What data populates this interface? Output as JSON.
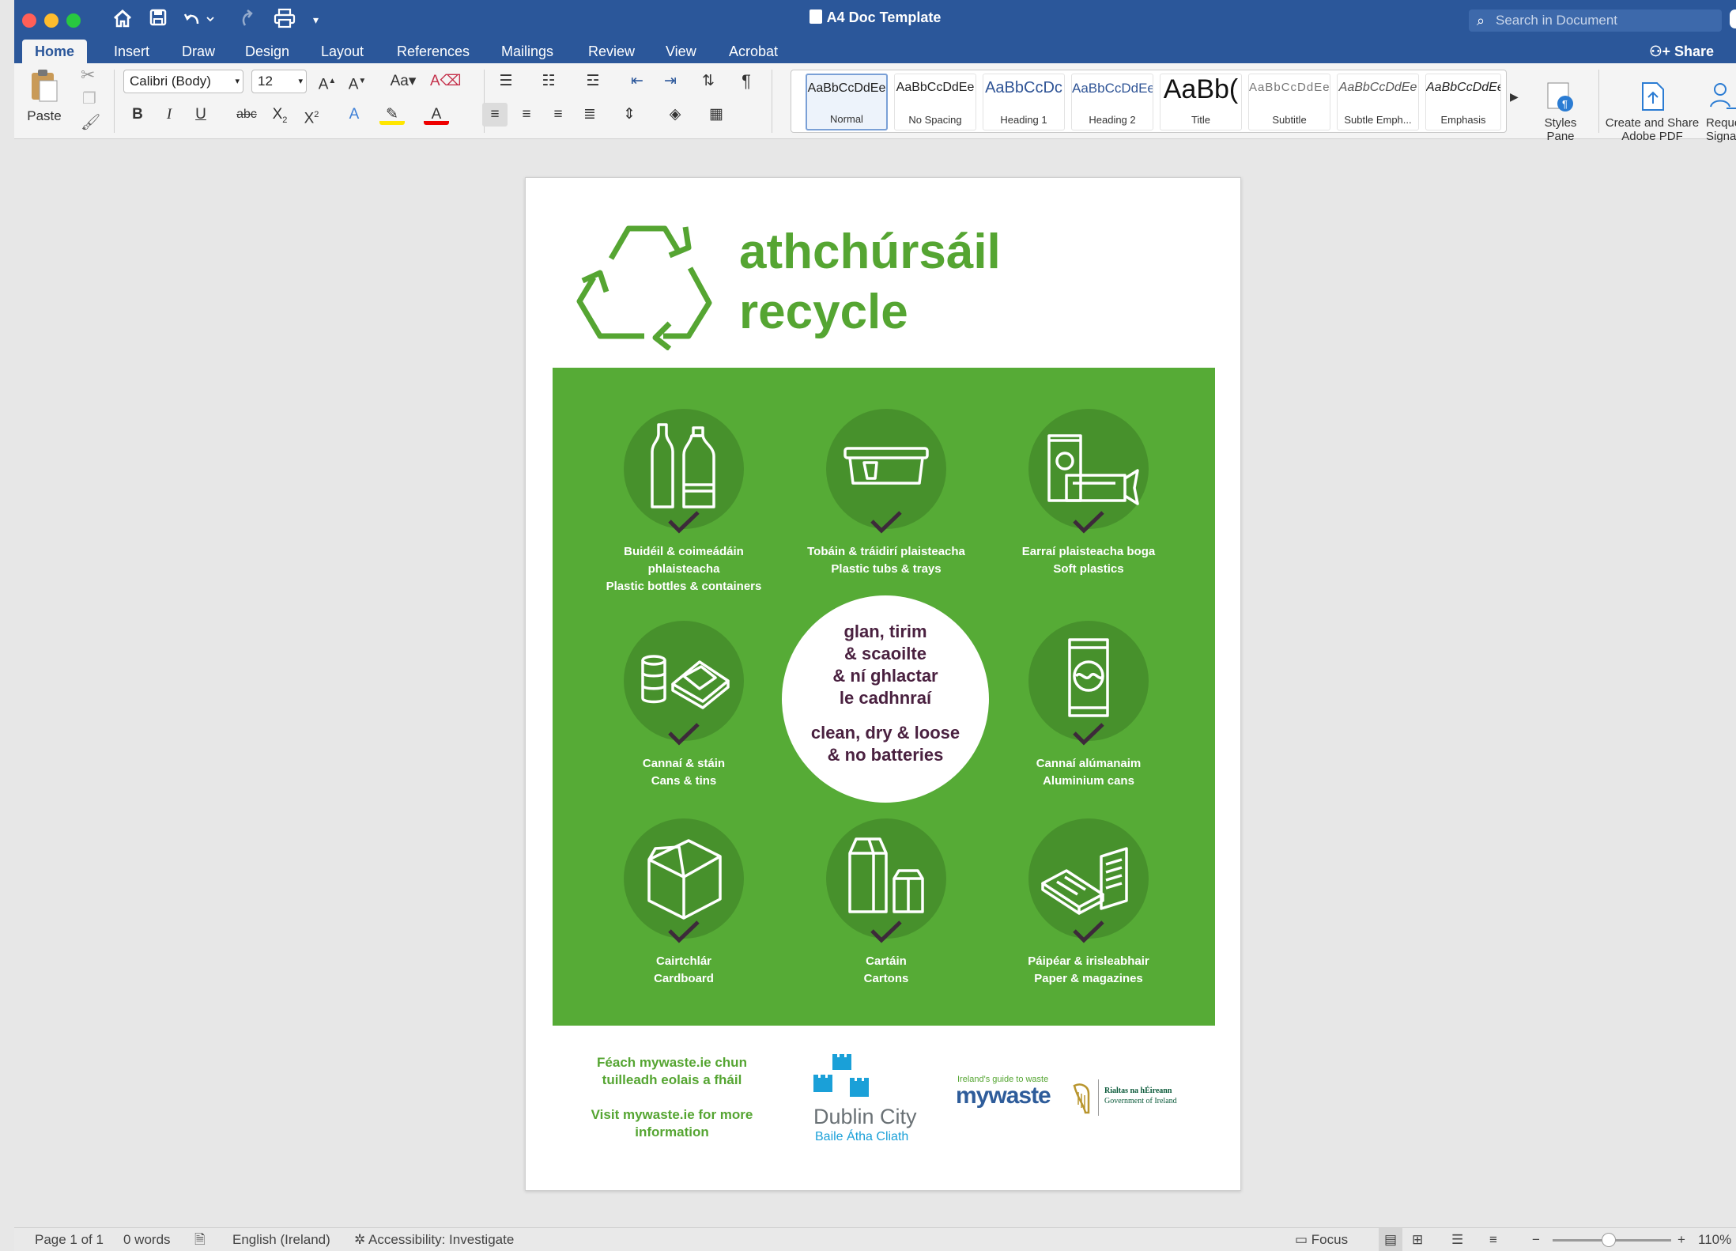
{
  "window": {
    "title": "A4 Doc Template",
    "search_placeholder": "Search in Document"
  },
  "tabs": [
    "Home",
    "Insert",
    "Draw",
    "Design",
    "Layout",
    "References",
    "Mailings",
    "Review",
    "View",
    "Acrobat"
  ],
  "share_label": "Share",
  "ribbon": {
    "paste_label": "Paste",
    "font_name": "Calibri (Body)",
    "font_size": "12",
    "bold": "B",
    "italic": "I",
    "underline": "U",
    "strikethrough": "abc",
    "styles": [
      {
        "preview": "AaBbCcDdEe",
        "name": "Normal"
      },
      {
        "preview": "AaBbCcDdEe",
        "name": "No Spacing"
      },
      {
        "preview": "AaBbCcDc",
        "name": "Heading 1"
      },
      {
        "preview": "AaBbCcDdEe",
        "name": "Heading 2"
      },
      {
        "preview": "AaBb(",
        "name": "Title"
      },
      {
        "preview": "AaBbCcDdEe",
        "name": "Subtitle"
      },
      {
        "preview": "AaBbCcDdEe",
        "name": "Subtle Emph..."
      },
      {
        "preview": "AaBbCcDdEe",
        "name": "Emphasis"
      }
    ],
    "styles_pane": "Styles\nPane",
    "create_share_pdf": "Create and Share\nAdobe PDF",
    "request_signatures": "Request\nSignatures"
  },
  "document": {
    "headline_irish": "athchúrsáil",
    "headline_english": "recycle",
    "items": [
      {
        "irish": "Buidéil & coimeádáin phlaisteacha",
        "english": "Plastic bottles & containers",
        "icon": "bottles-icon"
      },
      {
        "irish": "Tobáin & tráidirí plaisteacha",
        "english": "Plastic tubs & trays",
        "icon": "tub-icon"
      },
      {
        "irish": "Earraí plaisteacha boga",
        "english": "Soft plastics",
        "icon": "soft-plastics-icon"
      },
      {
        "irish": "Cannaí & stáin",
        "english": "Cans & tins",
        "icon": "tins-icon"
      },
      {
        "irish": "Cannaí alúmanaim",
        "english": "Aluminium cans",
        "icon": "can-icon"
      },
      {
        "irish": "Cairtchlár",
        "english": "Cardboard",
        "icon": "cardboard-box-icon"
      },
      {
        "irish": "Cartáin",
        "english": "Cartons",
        "icon": "carton-icon"
      },
      {
        "irish": "Páipéar & irisleabhair",
        "english": "Paper & magazines",
        "icon": "paper-icon"
      }
    ],
    "center_irish": [
      "glan, tirim",
      "& scaoilte",
      "& ní ghlactar",
      "le cadhnraí"
    ],
    "center_english": [
      "clean, dry & loose",
      "& no batteries"
    ],
    "footer_irish": "Féach mywaste.ie chun tuilleadh eolais a fháil",
    "footer_english": "Visit mywaste.ie for more information",
    "dublin_name": "Dublin City",
    "dublin_irish": "Baile Átha Cliath",
    "mywaste_tagline": "Ireland's guide to waste",
    "mywaste_logo": "mywaste",
    "gov_irish": "Rialtas na hÉireann",
    "gov_english": "Government of Ireland"
  },
  "status": {
    "page": "Page 1 of 1",
    "words": "0 words",
    "language": "English (Ireland)",
    "accessibility": "Accessibility: Investigate",
    "focus": "Focus",
    "zoom": "110%"
  },
  "colors": {
    "word_blue": "#2b579a",
    "recycle_green": "#56ab36",
    "circle_green": "#47912c",
    "center_text_purple": "#4a2140",
    "dublin_blue": "#1aa0d8"
  }
}
